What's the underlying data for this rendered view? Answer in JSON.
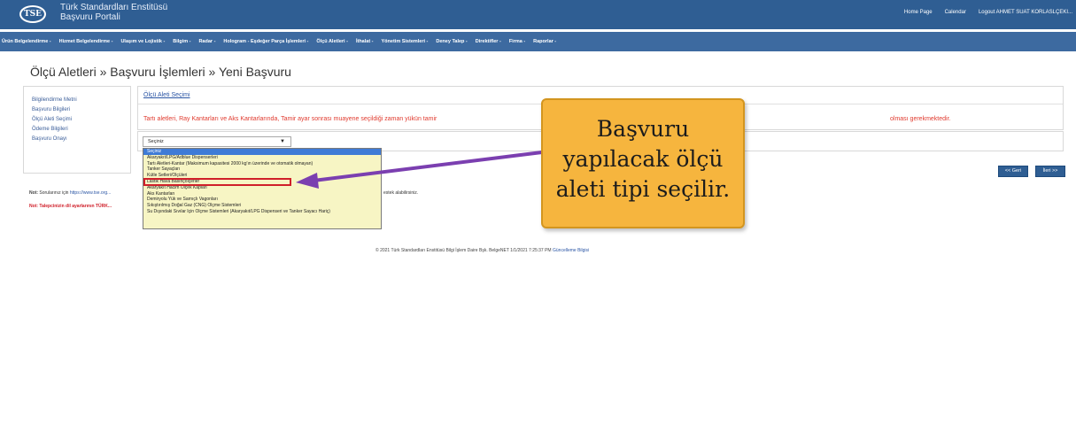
{
  "header": {
    "logo_text": "TSE",
    "brand_line1": "Türk Standardları Enstitüsü",
    "brand_line2": "Başvuru Portali",
    "links": [
      "Home Page",
      "Calendar",
      "Logout AHMET SUAT KORLASLÇEKI..."
    ]
  },
  "nav": {
    "items": [
      "Ürün Belgelendirme -",
      "Hizmet Belgelendirme -",
      "Ulaşım ve Lojistik -",
      "Bilgim -",
      "Radar -",
      "Hologram - Eşdeğer Parça İşlemleri -",
      "Ölçü Aletleri -",
      "İthalat -",
      "Yönetim Sistemleri -",
      "Deney Talep -",
      "Direktifler -",
      "Firma -",
      "Raporlar -"
    ]
  },
  "breadcrumb": "Ölçü Aletleri » Başvuru İşlemleri » Yeni Başvuru",
  "steps": [
    "Bilgilendirme Metni",
    "Başvuru Bilgileri",
    "Ölçü Aleti Seçimi",
    "Ödeme Bilgileri",
    "Başvuru Onayı"
  ],
  "panel": {
    "title": "Ölçü Aleti Seçimi",
    "warning_start": "Tartı aletleri, Ray Kantarları ve Aks Kantarlarında, Tamir ayar sonrası muayene seçildiği zaman yükün tamir",
    "warning_end": "olması gerekmektedir."
  },
  "select": {
    "value": "Seçiniz",
    "options": [
      "Seçiniz",
      "Akaryakıt/LPG/Adblue Dispenserleri",
      "Tartı Aletleri-Kantar (Maksimum kapasitesi 2000 kg'ın üzerinde ve otomatik olmayan)",
      "Tanker Sayaçları",
      "Kütle Setleri/Ölçüleri",
      "Lastik Hava Basınçölçerler",
      "Akaryakıt Hacim Ölçek Kapları",
      "Aks Kantarları",
      "Demiryolu Yük ve Sarnıçlı Vagonları",
      "Sıkıştırılmış Doğal Gaz (CNG) Ölçme Sistemleri",
      "Su Dışındaki Sıvılar İçin Ölçme Sistemleri (Akaryakıt/LPG Dispenseri ve Tanker Sayacı Hariç)"
    ],
    "selected_index": 0,
    "highlighted_index": 4
  },
  "notes": {
    "note1_label": "Not:",
    "note1_text": "Sorularınız için",
    "note1_link": "https://www.tse.org...",
    "note1_end": "estek alabilirsiniz.",
    "note2": "Not: Talepcinizin dil ayarlarının TÜRK..."
  },
  "buttons": {
    "back": "<< Geri",
    "next": "İleri >>"
  },
  "callout": {
    "lines": [
      "Başvuru",
      "yapılacak ölçü",
      "aleti tipi seçilir."
    ]
  },
  "footer": {
    "text": "© 2021 Türk Standardları Enstitüsü Bilgi İşlem Daire Bşk. BelgeNET  1/1/2021 7:25:37 PM",
    "link": "Güncelleme Bilgisi"
  },
  "colors": {
    "header_bg": "#2f5e93",
    "nav_bg": "#3d6aa0",
    "warning": "#e03a2e",
    "callout_bg": "#f6b53e",
    "arrow": "#7b3fb0",
    "dropdown_bg": "#f7f5c4"
  }
}
